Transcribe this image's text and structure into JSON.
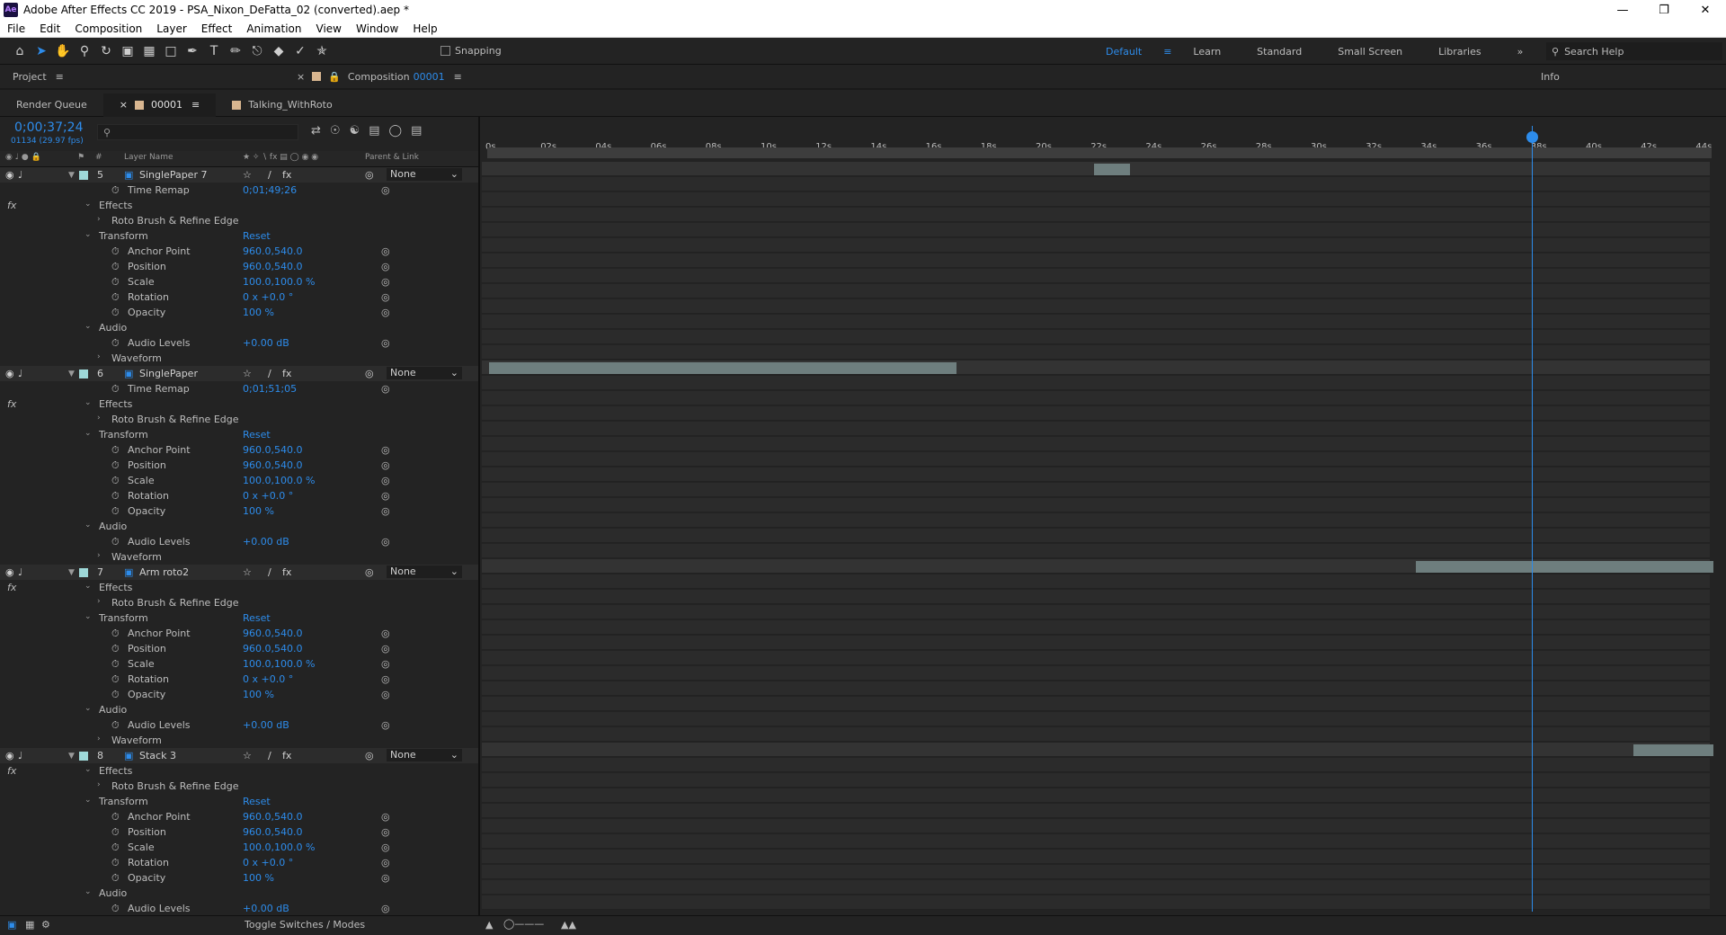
{
  "window": {
    "title": "Adobe After Effects CC 2019 - PSA_Nixon_DeFatta_02 (converted).aep *",
    "app_badge": "Ae"
  },
  "menu": [
    "File",
    "Edit",
    "Composition",
    "Layer",
    "Effect",
    "Animation",
    "View",
    "Window",
    "Help"
  ],
  "toolbar": {
    "snapping": "Snapping",
    "workspaces": [
      "Default",
      "Learn",
      "Standard",
      "Small Screen",
      "Libraries"
    ],
    "search_help": "Search Help"
  },
  "panels": {
    "project": "Project",
    "composition_label": "Composition",
    "composition_name": "00001",
    "info": "Info"
  },
  "timeline_tabs": [
    "Render Queue",
    "00001",
    "Talking_WithRoto"
  ],
  "timeline": {
    "timecode": "0;00;37;24",
    "subtimecode": "01134 (29.97 fps)",
    "col_layer_name": "Layer Name",
    "col_parent": "Parent & Link",
    "ruler": [
      "0s",
      "02s",
      "04s",
      "06s",
      "08s",
      "10s",
      "12s",
      "14s",
      "16s",
      "18s",
      "20s",
      "22s",
      "24s",
      "26s",
      "28s",
      "30s",
      "32s",
      "34s",
      "36s",
      "38s",
      "40s",
      "42s",
      "44s"
    ],
    "toggle_label": "Toggle Switches / Modes"
  },
  "rows": [
    {
      "kind": "layer",
      "num": "5",
      "name": "SinglePaper 7",
      "parent": "None"
    },
    {
      "kind": "prop",
      "indent": 2,
      "name": "Time Remap",
      "value": "0;01;49;26",
      "stopwatch": true
    },
    {
      "kind": "group",
      "indent": 1,
      "name": "Effects"
    },
    {
      "kind": "sub",
      "indent": 2,
      "name": "Roto Brush & Refine Edge"
    },
    {
      "kind": "group",
      "indent": 1,
      "name": "Transform",
      "value": "Reset"
    },
    {
      "kind": "prop",
      "indent": 2,
      "name": "Anchor Point",
      "value": "960.0,540.0"
    },
    {
      "kind": "prop",
      "indent": 2,
      "name": "Position",
      "value": "960.0,540.0"
    },
    {
      "kind": "prop",
      "indent": 2,
      "name": "Scale",
      "value": "100.0,100.0 %"
    },
    {
      "kind": "prop",
      "indent": 2,
      "name": "Rotation",
      "value": "0 x +0.0 °"
    },
    {
      "kind": "prop",
      "indent": 2,
      "name": "Opacity",
      "value": "100 %"
    },
    {
      "kind": "group",
      "indent": 1,
      "name": "Audio"
    },
    {
      "kind": "prop",
      "indent": 2,
      "name": "Audio Levels",
      "value": "+0.00 dB"
    },
    {
      "kind": "sub",
      "indent": 2,
      "name": "Waveform"
    },
    {
      "kind": "layer",
      "num": "6",
      "name": "SinglePaper",
      "parent": "None"
    },
    {
      "kind": "prop",
      "indent": 2,
      "name": "Time Remap",
      "value": "0;01;51;05",
      "stopwatch": true
    },
    {
      "kind": "group",
      "indent": 1,
      "name": "Effects"
    },
    {
      "kind": "sub",
      "indent": 2,
      "name": "Roto Brush & Refine Edge"
    },
    {
      "kind": "group",
      "indent": 1,
      "name": "Transform",
      "value": "Reset"
    },
    {
      "kind": "prop",
      "indent": 2,
      "name": "Anchor Point",
      "value": "960.0,540.0"
    },
    {
      "kind": "prop",
      "indent": 2,
      "name": "Position",
      "value": "960.0,540.0"
    },
    {
      "kind": "prop",
      "indent": 2,
      "name": "Scale",
      "value": "100.0,100.0 %"
    },
    {
      "kind": "prop",
      "indent": 2,
      "name": "Rotation",
      "value": "0 x +0.0 °"
    },
    {
      "kind": "prop",
      "indent": 2,
      "name": "Opacity",
      "value": "100 %"
    },
    {
      "kind": "group",
      "indent": 1,
      "name": "Audio"
    },
    {
      "kind": "prop",
      "indent": 2,
      "name": "Audio Levels",
      "value": "+0.00 dB"
    },
    {
      "kind": "sub",
      "indent": 2,
      "name": "Waveform"
    },
    {
      "kind": "layer",
      "num": "7",
      "name": "Arm roto2",
      "parent": "None"
    },
    {
      "kind": "group",
      "indent": 1,
      "name": "Effects"
    },
    {
      "kind": "sub",
      "indent": 2,
      "name": "Roto Brush & Refine Edge"
    },
    {
      "kind": "group",
      "indent": 1,
      "name": "Transform",
      "value": "Reset"
    },
    {
      "kind": "prop",
      "indent": 2,
      "name": "Anchor Point",
      "value": "960.0,540.0"
    },
    {
      "kind": "prop",
      "indent": 2,
      "name": "Position",
      "value": "960.0,540.0"
    },
    {
      "kind": "prop",
      "indent": 2,
      "name": "Scale",
      "value": "100.0,100.0 %"
    },
    {
      "kind": "prop",
      "indent": 2,
      "name": "Rotation",
      "value": "0 x +0.0 °"
    },
    {
      "kind": "prop",
      "indent": 2,
      "name": "Opacity",
      "value": "100 %"
    },
    {
      "kind": "group",
      "indent": 1,
      "name": "Audio"
    },
    {
      "kind": "prop",
      "indent": 2,
      "name": "Audio Levels",
      "value": "+0.00 dB"
    },
    {
      "kind": "sub",
      "indent": 2,
      "name": "Waveform"
    },
    {
      "kind": "layer",
      "num": "8",
      "name": "Stack 3",
      "parent": "None"
    },
    {
      "kind": "group",
      "indent": 1,
      "name": "Effects"
    },
    {
      "kind": "sub",
      "indent": 2,
      "name": "Roto Brush & Refine Edge"
    },
    {
      "kind": "group",
      "indent": 1,
      "name": "Transform",
      "value": "Reset"
    },
    {
      "kind": "prop",
      "indent": 2,
      "name": "Anchor Point",
      "value": "960.0,540.0"
    },
    {
      "kind": "prop",
      "indent": 2,
      "name": "Position",
      "value": "960.0,540.0"
    },
    {
      "kind": "prop",
      "indent": 2,
      "name": "Scale",
      "value": "100.0,100.0 %"
    },
    {
      "kind": "prop",
      "indent": 2,
      "name": "Rotation",
      "value": "0 x +0.0 °"
    },
    {
      "kind": "prop",
      "indent": 2,
      "name": "Opacity",
      "value": "100 %"
    },
    {
      "kind": "group",
      "indent": 1,
      "name": "Audio"
    },
    {
      "kind": "prop",
      "indent": 2,
      "name": "Audio Levels",
      "value": "+0.00 dB"
    }
  ],
  "layer_bars": [
    {
      "layer": "5",
      "start_s": 22.0,
      "end_s": 23.3
    },
    {
      "layer": "6",
      "start_s": 0.0,
      "end_s": 17.0
    },
    {
      "layer": "7",
      "start_s": 33.7,
      "end_s": 44.5
    },
    {
      "layer": "8",
      "start_s": 41.6,
      "end_s": 44.5
    }
  ],
  "playhead_s": 37.9,
  "colors": {
    "accent": "#2d8ceb",
    "label_swatch": "#9ed9d9",
    "bar": "#6e7e7e"
  }
}
